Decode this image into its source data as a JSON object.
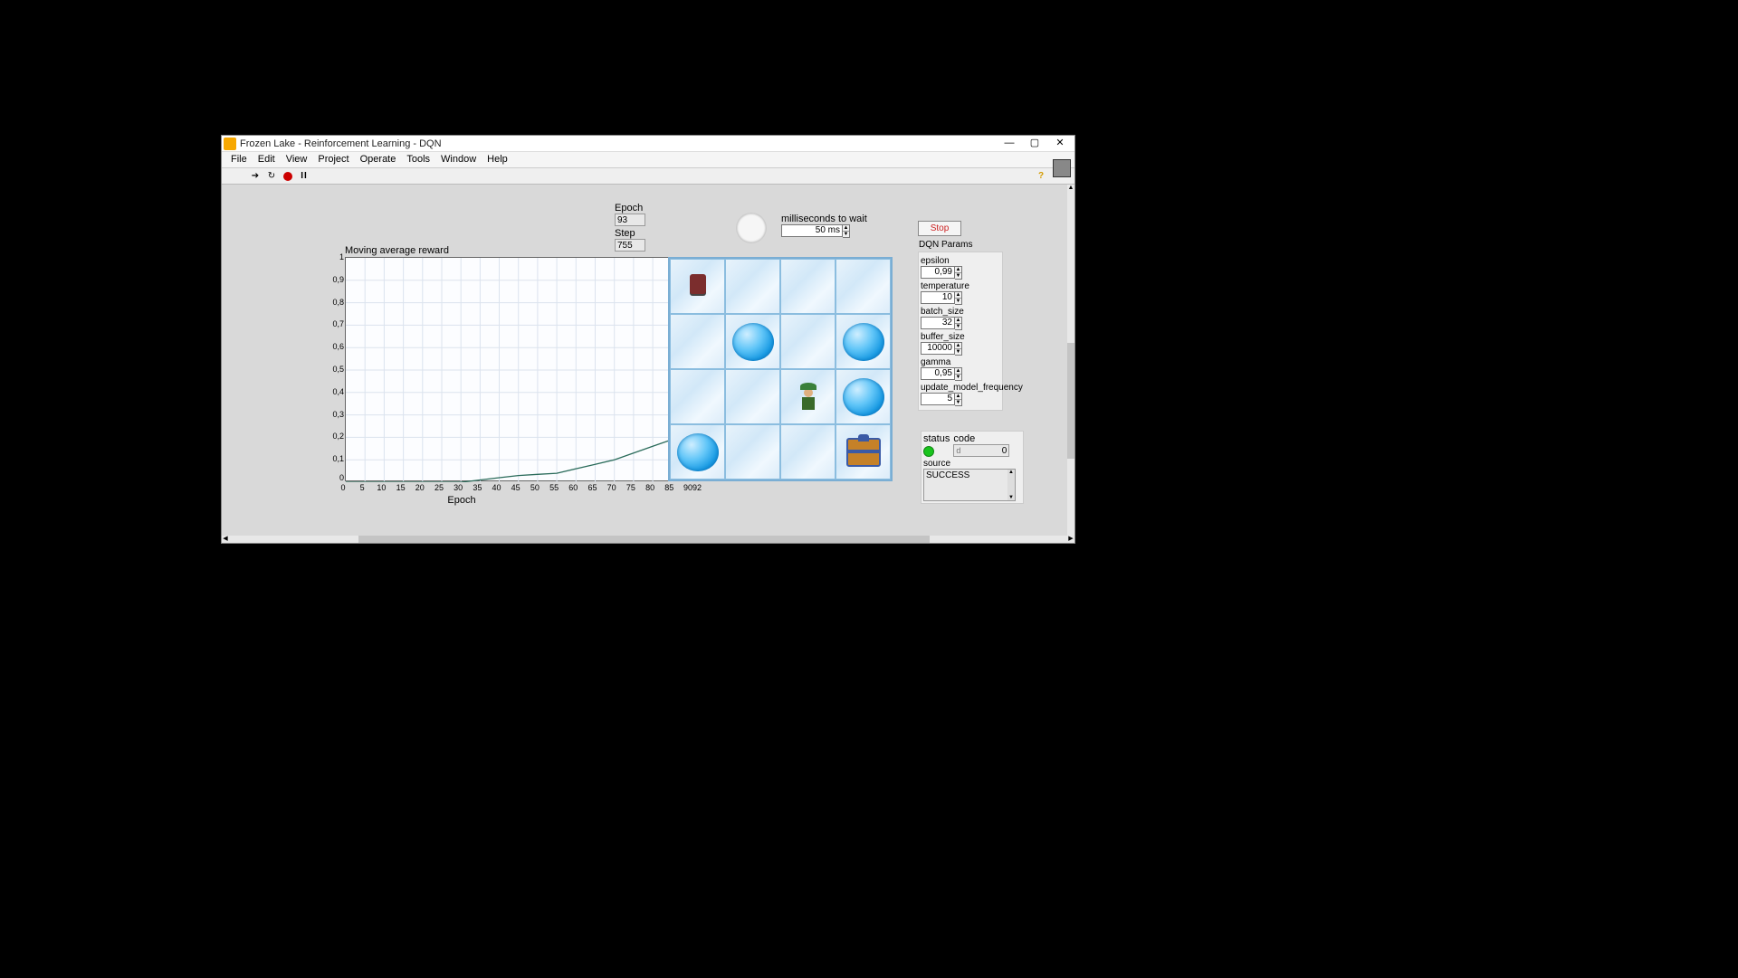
{
  "window": {
    "title": "Frozen Lake - Reinforcement Learning - DQN"
  },
  "menu": [
    "File",
    "Edit",
    "View",
    "Project",
    "Operate",
    "Tools",
    "Window",
    "Help"
  ],
  "epoch": {
    "label": "Epoch",
    "value": "93"
  },
  "step": {
    "label": "Step",
    "value": "755"
  },
  "indicator": {
    "state": "off"
  },
  "ms_wait": {
    "label": "milliseconds to wait",
    "value": "50 ms"
  },
  "stop_label": "Stop",
  "chart": {
    "title": "Moving average reward",
    "xlabel": "Epoch"
  },
  "chart_data": {
    "type": "line",
    "title": "Moving average reward",
    "xlabel": "Epoch",
    "ylabel": "",
    "xlim": [
      0,
      92
    ],
    "ylim": [
      0,
      1
    ],
    "x_ticks": [
      0,
      5,
      10,
      15,
      20,
      25,
      30,
      35,
      40,
      45,
      50,
      55,
      60,
      65,
      70,
      75,
      80,
      85,
      90,
      92
    ],
    "y_ticks": [
      0,
      0.1,
      0.2,
      0.3,
      0.4,
      0.5,
      0.6,
      0.7,
      0.8,
      0.9,
      1
    ],
    "series": [
      {
        "name": "Moving average reward",
        "x": [
          0,
          5,
          10,
          15,
          20,
          25,
          30,
          35,
          40,
          45,
          50,
          55,
          60,
          65,
          70,
          75,
          80,
          85,
          90,
          92
        ],
        "y": [
          0,
          0,
          0,
          0,
          0,
          0,
          0,
          0.01,
          0.02,
          0.03,
          0.035,
          0.04,
          0.06,
          0.08,
          0.1,
          0.13,
          0.16,
          0.19,
          0.21,
          0.22
        ]
      }
    ]
  },
  "y_tick_labels": [
    "1",
    "0,9",
    "0,8",
    "0,7",
    "0,6",
    "0,5",
    "0,4",
    "0,3",
    "0,2",
    "0,1",
    "0"
  ],
  "x_tick_labels": [
    "0",
    "5",
    "10",
    "15",
    "20",
    "25",
    "30",
    "35",
    "40",
    "45",
    "50",
    "55",
    "60",
    "65",
    "70",
    "75",
    "80",
    "85",
    "9092"
  ],
  "game_grid": {
    "rows": 4,
    "cols": 4,
    "cells": [
      [
        "start",
        "ice",
        "ice",
        "ice"
      ],
      [
        "ice",
        "hole",
        "ice",
        "hole"
      ],
      [
        "ice",
        "ice",
        "agent",
        "hole"
      ],
      [
        "hole",
        "ice",
        "ice",
        "goal"
      ]
    ]
  },
  "dqn": {
    "title": "DQN Params",
    "params": [
      {
        "label": "epsilon",
        "value": "0,99"
      },
      {
        "label": "temperature",
        "value": "10"
      },
      {
        "label": "batch_size",
        "value": "32"
      },
      {
        "label": "buffer_size",
        "value": "10000"
      },
      {
        "label": "gamma",
        "value": "0,95"
      },
      {
        "label": "update_model_frequency",
        "value": "5"
      }
    ]
  },
  "status": {
    "status_label": "status",
    "code_label": "code",
    "code_d": "d",
    "code_value": "0",
    "source_label": "source",
    "source_value": "SUCCESS"
  }
}
